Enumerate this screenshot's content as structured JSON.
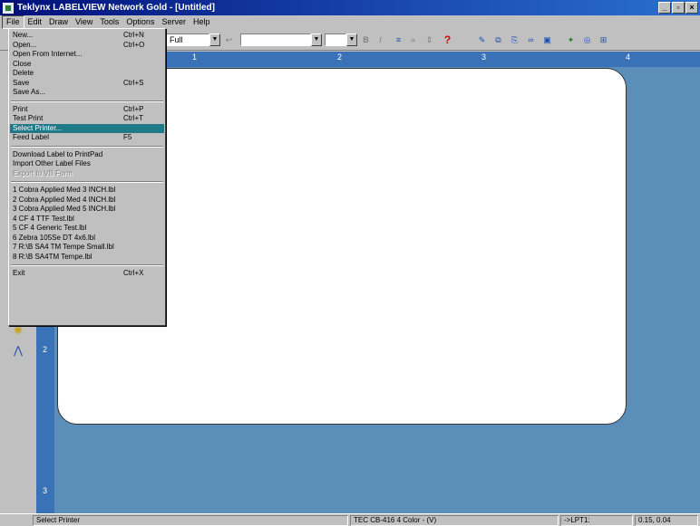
{
  "window": {
    "title": "Teklynx LABELVIEW Network Gold - [Untitled]",
    "controls": [
      "_",
      "▫",
      "×"
    ]
  },
  "menubar": [
    "File",
    "Edit",
    "Draw",
    "View",
    "Tools",
    "Options",
    "Server",
    "Help"
  ],
  "toolbar": {
    "zoom_value": "Full",
    "font_size_value": "",
    "font_name_value": "",
    "bold_label": "B",
    "italic_label": "I",
    "help_label": "?"
  },
  "file_menu": {
    "groups": [
      [
        {
          "label": "New...",
          "shortcut": "Ctrl+N"
        },
        {
          "label": "Open...",
          "shortcut": "Ctrl+O"
        },
        {
          "label": "Open From Internet...",
          "shortcut": ""
        },
        {
          "label": "Close",
          "shortcut": ""
        },
        {
          "label": "Delete",
          "shortcut": ""
        },
        {
          "label": "Save",
          "shortcut": "Ctrl+S"
        },
        {
          "label": "Save As...",
          "shortcut": ""
        }
      ],
      [
        {
          "label": "Print",
          "shortcut": "Ctrl+P"
        },
        {
          "label": "Test Print",
          "shortcut": "Ctrl+T"
        },
        {
          "label": "Select Printer...",
          "shortcut": "",
          "selected": true
        },
        {
          "label": "Feed Label",
          "shortcut": "F5"
        }
      ],
      [
        {
          "label": "Download Label to PrintPad",
          "shortcut": ""
        },
        {
          "label": "Import Other Label Files",
          "shortcut": ""
        },
        {
          "label": "Export to VB Form",
          "shortcut": "",
          "disabled": true
        }
      ],
      [
        {
          "label": "1 Cobra Applied Med 3 INCH.lbl",
          "shortcut": ""
        },
        {
          "label": "2 Cobra Applied Med 4 INCH.lbl",
          "shortcut": ""
        },
        {
          "label": "3 Cobra Applied Med 5 INCH.lbl",
          "shortcut": ""
        },
        {
          "label": "4 CF 4 TTF Test.lbl",
          "shortcut": ""
        },
        {
          "label": "5 CF 4 Generic Test.lbl",
          "shortcut": ""
        },
        {
          "label": "6 Zebra 105Se DT 4x6.lbl",
          "shortcut": ""
        },
        {
          "label": "7 R:\\B SA4 TM Tempe Small.lbl",
          "shortcut": ""
        },
        {
          "label": "8 R:\\B SA4TM Tempe.lbl",
          "shortcut": ""
        }
      ],
      [
        {
          "label": "Exit",
          "shortcut": "Ctrl+X"
        }
      ]
    ]
  },
  "rulers": {
    "horizontal": [
      "1",
      "2",
      "3",
      "4"
    ],
    "vertical": [
      "2",
      "3"
    ]
  },
  "statusbar": {
    "hint": "Select Printer",
    "printer": "TEC CB-416 4 Color - (V)",
    "port": "->LPT1:",
    "coords": "0.15, 0.04"
  },
  "colors": {
    "workspace": "#5b8eb9",
    "ruler": "#3a72b8",
    "selection": "#1e7a86",
    "titlebar": "#00107a"
  }
}
